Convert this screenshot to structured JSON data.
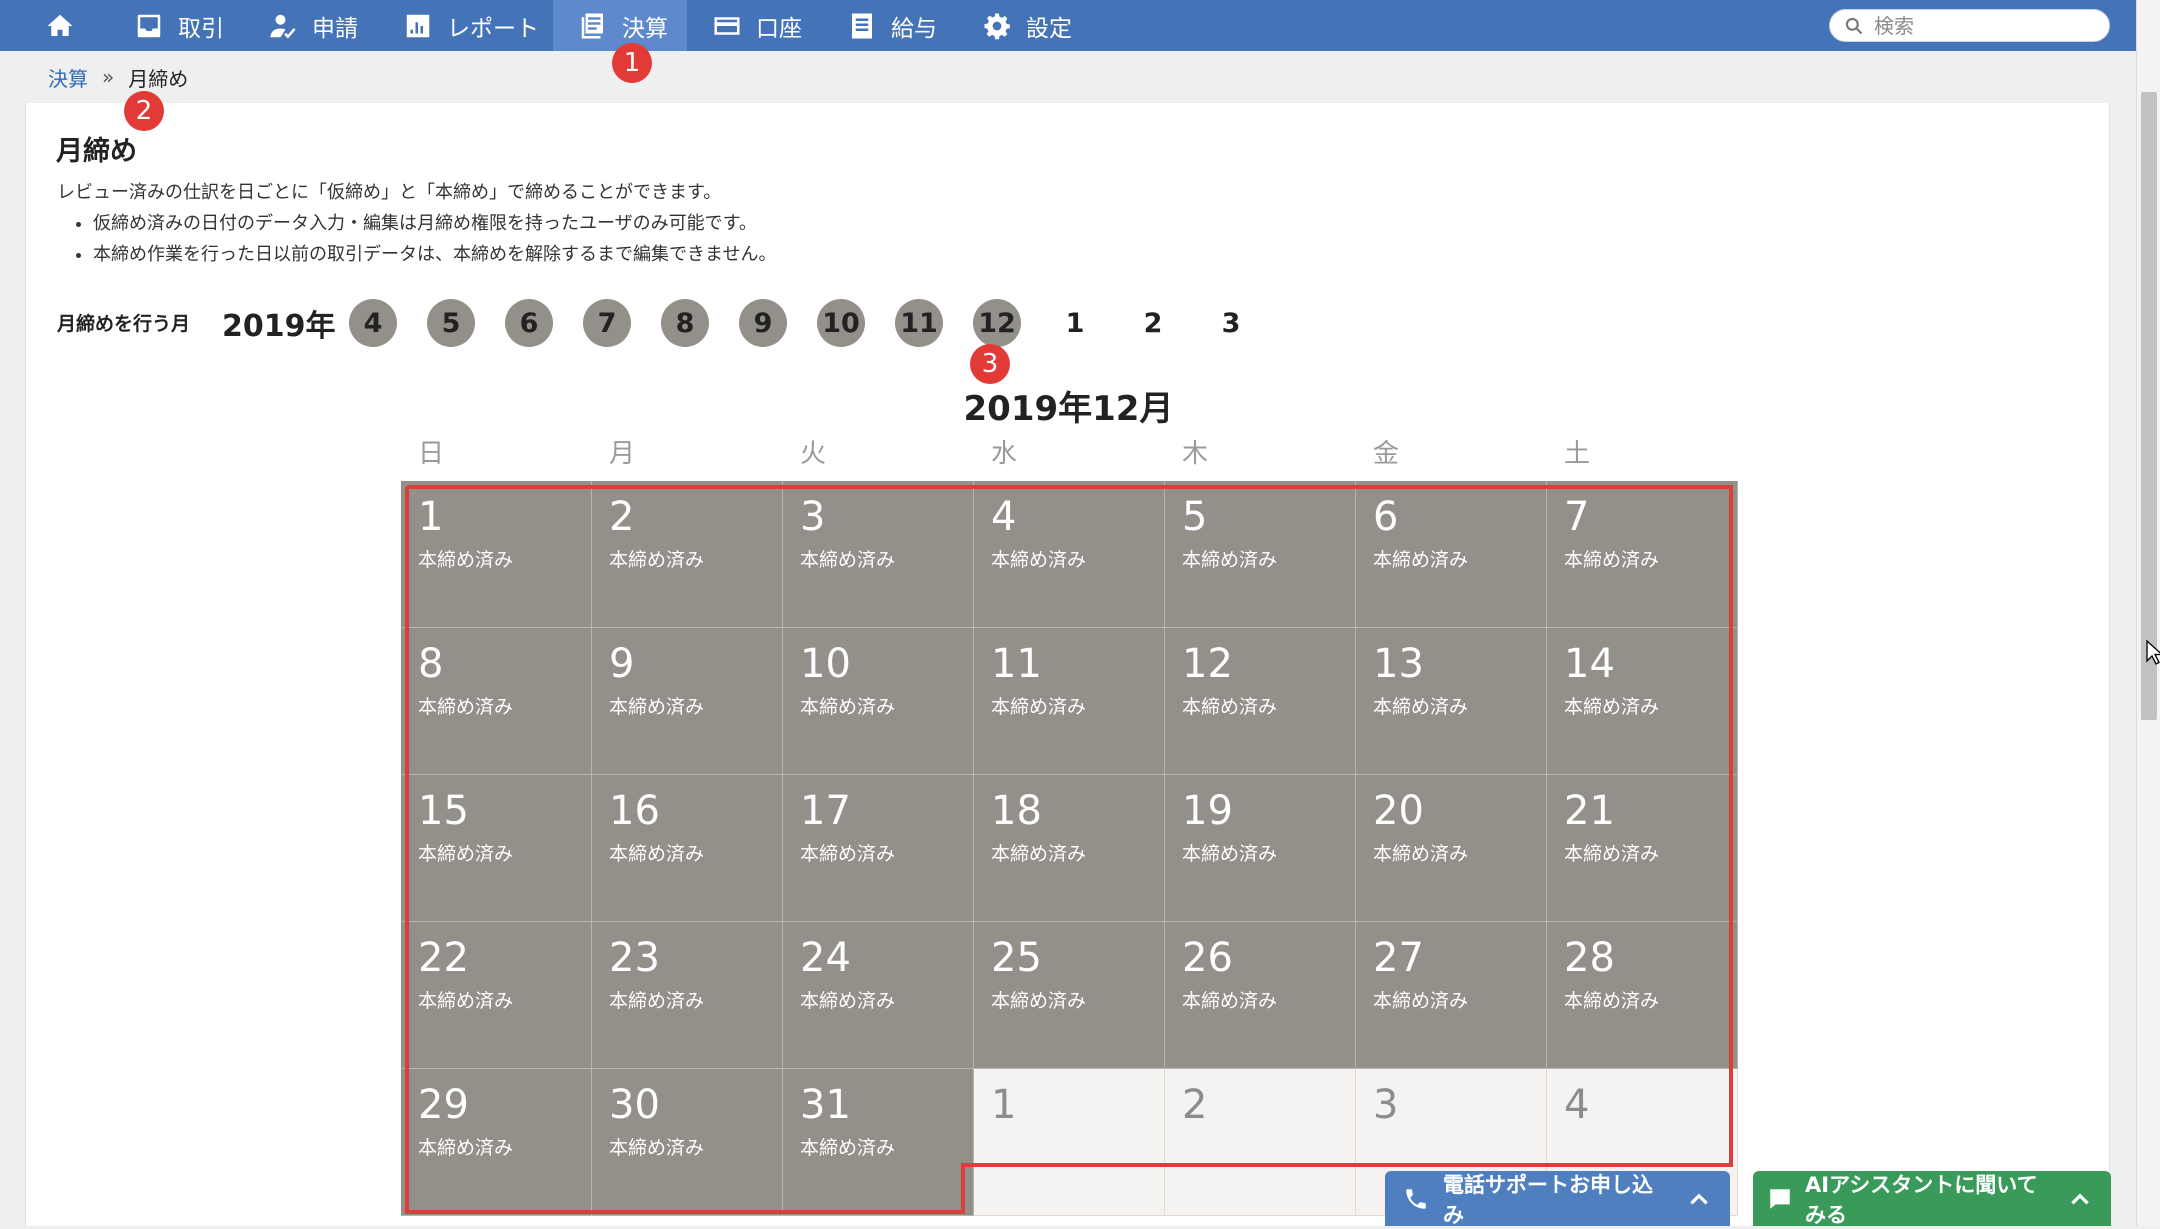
{
  "nav": {
    "items": [
      {
        "label": "",
        "icon": "home-icon"
      },
      {
        "label": "取引",
        "icon": "inbox-icon"
      },
      {
        "label": "申請",
        "icon": "user-check-icon"
      },
      {
        "label": "レポート",
        "icon": "bar-chart-icon"
      },
      {
        "label": "決算",
        "icon": "ledger-icon",
        "active": true
      },
      {
        "label": "口座",
        "icon": "credit-card-icon"
      },
      {
        "label": "給与",
        "icon": "payslip-icon"
      },
      {
        "label": "設定",
        "icon": "gear-icon"
      }
    ],
    "search_placeholder": "検索"
  },
  "breadcrumb": {
    "parent": "決算",
    "separator": "»",
    "current": "月締め"
  },
  "page": {
    "title": "月締め",
    "description": "レビュー済みの仕訳を日ごとに「仮締め」と「本締め」で締めることができます。",
    "notes": [
      "仮締め済みの日付のデータ入力・編集は月締め権限を持ったユーザのみ可能です。",
      "本締め作業を行った日以前の取引データは、本締めを解除するまで編集できません。"
    ]
  },
  "month_selector": {
    "label": "月締めを行う月",
    "year": "2019年",
    "months": [
      {
        "label": "4",
        "closed": true
      },
      {
        "label": "5",
        "closed": true
      },
      {
        "label": "6",
        "closed": true
      },
      {
        "label": "7",
        "closed": true
      },
      {
        "label": "8",
        "closed": true
      },
      {
        "label": "9",
        "closed": true
      },
      {
        "label": "10",
        "closed": true
      },
      {
        "label": "11",
        "closed": true
      },
      {
        "label": "12",
        "closed": true,
        "selected": true
      },
      {
        "label": "1",
        "closed": false
      },
      {
        "label": "2",
        "closed": false
      },
      {
        "label": "3",
        "closed": false
      }
    ]
  },
  "calendar": {
    "title": "2019年12月",
    "weekdays": [
      "日",
      "月",
      "火",
      "水",
      "木",
      "金",
      "土"
    ],
    "status_label": "本締め済み",
    "days": [
      "1",
      "2",
      "3",
      "4",
      "5",
      "6",
      "7",
      "8",
      "9",
      "10",
      "11",
      "12",
      "13",
      "14",
      "15",
      "16",
      "17",
      "18",
      "19",
      "20",
      "21",
      "22",
      "23",
      "24",
      "25",
      "26",
      "27",
      "28",
      "29",
      "30",
      "31"
    ],
    "next_month_days": [
      "1",
      "2",
      "3",
      "4"
    ]
  },
  "badges": [
    "1",
    "2",
    "3"
  ],
  "footer": {
    "phone_support": "電話サポートお申し込み",
    "ai_assistant": "AIアシスタントに聞いてみる"
  },
  "colors": {
    "nav_bg": "#4573b7",
    "nav_active": "#5e8acb",
    "closed_day": "#938f89",
    "highlight": "#d9403c",
    "badge": "#e23a36",
    "phone_btn": "#4f7fbf",
    "ai_btn": "#3a9a5a"
  }
}
